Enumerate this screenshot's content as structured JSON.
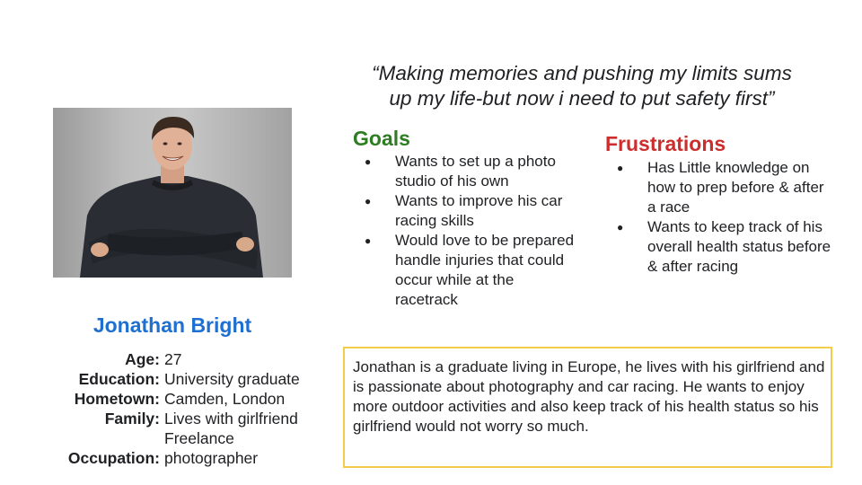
{
  "persona": {
    "name": "Jonathan Bright",
    "details": [
      {
        "label": "Age:",
        "value": "27"
      },
      {
        "label": "Education:",
        "value": "University graduate"
      },
      {
        "label": "Hometown:",
        "value": "Camden, London"
      },
      {
        "label": "Family:",
        "value": "Lives with girlfriend"
      },
      {
        "label": "",
        "value": "Freelance"
      },
      {
        "label": "Occupation:",
        "value": "photographer"
      }
    ]
  },
  "quote": {
    "line1": "“Making memories and pushing my limits sums",
    "line2": "up my life-but now i need to put safety first”"
  },
  "goals": {
    "title": "Goals",
    "items": [
      "Wants to set up a photo studio of his own",
      "Wants to improve his car racing skills",
      "Would love to be prepared handle injuries that could occur while at the racetrack"
    ]
  },
  "frustrations": {
    "title": "Frustrations",
    "items": [
      "Has Little knowledge on how to prep before & after a race",
      "Wants to keep track of his overall health status before & after racing"
    ]
  },
  "bio": "Jonathan is  a graduate living in Europe, he lives with his girlfriend and is passionate about photography and car racing. He wants to enjoy more outdoor activities and also keep track of his health status so his girlfriend would not worry so much.",
  "colors": {
    "name": "#1f6fd1",
    "goals_title": "#2e7d23",
    "frustrations_title": "#cc2e2e",
    "bio_border": "#f2cd4c"
  }
}
